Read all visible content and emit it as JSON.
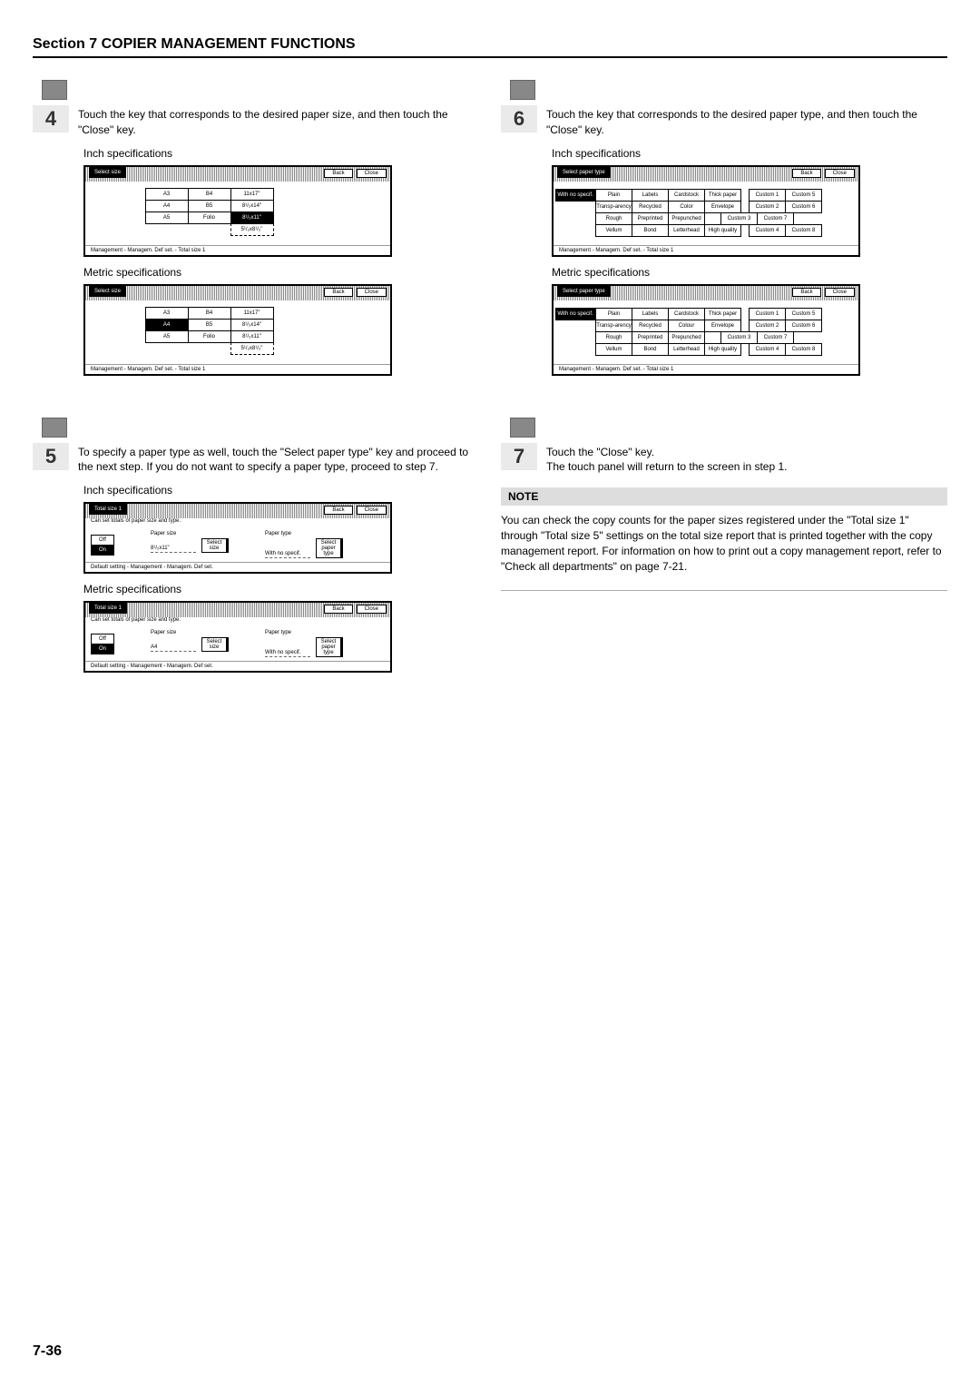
{
  "section_title": "Section 7  COPIER MANAGEMENT FUNCTIONS",
  "page_number": "7-36",
  "steps": {
    "s4": {
      "num": "4",
      "text": "Touch the key that corresponds to the desired paper size, and then touch the \"Close\" key."
    },
    "s5": {
      "num": "5",
      "text": "To specify a paper type as well, touch the \"Select paper type\" key and proceed to the next step. If you do not want to specify a paper type, proceed to step 7."
    },
    "s6": {
      "num": "6",
      "text": "Touch the key that corresponds to the desired paper type, and then touch the \"Close\" key."
    },
    "s7": {
      "num": "7",
      "text": "Touch the \"Close\" key.\nThe touch panel will return to the screen in step 1."
    }
  },
  "labels": {
    "inch_spec": "Inch specifications",
    "metric_spec": "Metric specifications",
    "back": "Back",
    "close": "Close",
    "note": "NOTE"
  },
  "panels": {
    "size_inch": {
      "title": "Select size",
      "foot": "Management - Managem. Def set. - Total size 1",
      "col1": [
        "A3",
        "A4",
        "A5"
      ],
      "col2": [
        "B4",
        "B5",
        "Folio"
      ],
      "col3": [
        "11x17\"",
        "8¹/₂x14\"",
        "8¹/₂x11\"",
        "5¹/₂x8¹/₂\""
      ],
      "selected": "8¹/₂x11\""
    },
    "size_metric": {
      "title": "Select size",
      "foot": "Management - Managem. Def set. - Total size 1",
      "col1": [
        "A3",
        "A4",
        "A5"
      ],
      "col2": [
        "B4",
        "B5",
        "Folio"
      ],
      "col3": [
        "11x17\"",
        "8¹/₂x14\"",
        "8¹/₂x11\"",
        "5¹/₂x8¹/₂\""
      ],
      "selected": "A4"
    },
    "total_inch": {
      "title": "Total size 1",
      "sub": "Can set totals of paper size and type.",
      "paper_size": "Paper size",
      "paper_type": "Paper type",
      "size_value": "8¹/₂x11\"",
      "with_no": "With no specif.",
      "select_size": "Select size",
      "select_type": "Select paper type",
      "off": "Off",
      "on": "On",
      "foot": "Default setting - Management - Managem. Def set."
    },
    "total_metric": {
      "title": "Total size 1",
      "sub": "Can set totals of paper size and type.",
      "paper_size": "Paper size",
      "paper_type": "Paper type",
      "size_value": "A4",
      "with_no": "With no specif.",
      "select_size": "Select size",
      "select_type": "Select paper type",
      "off": "Off",
      "on": "On",
      "foot": "Default setting - Management - Managem. Def set."
    },
    "type_inch": {
      "title": "Select paper type",
      "foot": "Management - Managem. Def set. - Total size 1",
      "left": "With no specif.",
      "rows": [
        [
          "Plain",
          "Labels",
          "Cardstock",
          "Thick paper",
          "",
          "Custom 1",
          "Custom 5"
        ],
        [
          "Transp-arency",
          "Recycled",
          "Color",
          "Envelope",
          "",
          "Custom 2",
          "Custom 6"
        ],
        [
          "Rough",
          "Preprinted",
          "Prepunched",
          "",
          "",
          "Custom 3",
          "Custom 7"
        ],
        [
          "Vellum",
          "Bond",
          "Letterhead",
          "High quality",
          "",
          "Custom 4",
          "Custom 8"
        ]
      ]
    },
    "type_metric": {
      "title": "Select paper type",
      "foot": "Management - Managem. Def set. - Total size 1",
      "left": "With no specif.",
      "rows": [
        [
          "Plain",
          "Labels",
          "Cardstock",
          "Thick paper",
          "",
          "Custom 1",
          "Custom 5"
        ],
        [
          "Transp-arency",
          "Recycled",
          "Colour",
          "Envelope",
          "",
          "Custom 2",
          "Custom 6"
        ],
        [
          "Rough",
          "Preprinted",
          "Prepunched",
          "",
          "",
          "Custom 3",
          "Custom 7"
        ],
        [
          "Vellum",
          "Bond",
          "Letterhead",
          "High quality",
          "",
          "Custom 4",
          "Custom 8"
        ]
      ]
    }
  },
  "note_text": "You can check the copy counts for the paper sizes registered under the \"Total size 1\" through \"Total size 5\" settings on the total size report that is printed together with the copy management report. For information on how to print out a copy management report, refer to \"Check all departments\" on page 7-21."
}
